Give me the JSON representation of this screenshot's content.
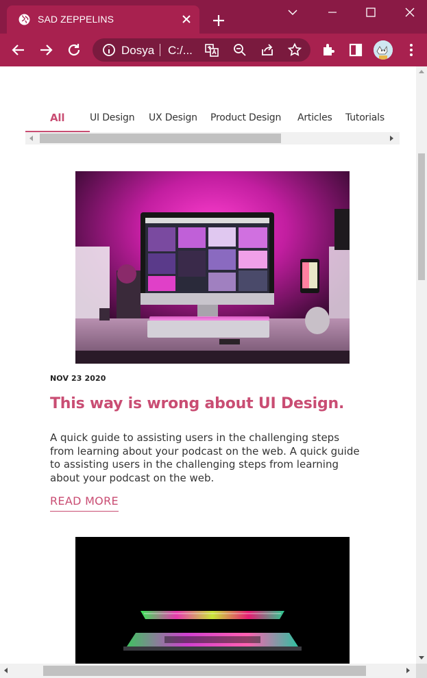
{
  "browser": {
    "tab_title": "SAD ZEPPELINS",
    "omnibox_site": "Dosya",
    "omnibox_path": "C:/...",
    "colors": {
      "frame": "#8a1a45",
      "toolbar": "#a8214f",
      "omnibox": "#7a1a3e"
    }
  },
  "categories": {
    "items": [
      {
        "label": "All",
        "active": true
      },
      {
        "label": "UI Design",
        "active": false
      },
      {
        "label": "UX Design",
        "active": false
      },
      {
        "label": "Product Design",
        "active": false
      },
      {
        "label": "Articles",
        "active": false
      },
      {
        "label": "Tutorials",
        "active": false
      }
    ]
  },
  "posts": [
    {
      "image": "desk-computer-pink-light",
      "date": "NOV 23 2020",
      "title": "This way is wrong about UI Design.",
      "excerpt": "A quick guide to assisting users in the challenging steps from learning about your podcast on the web. A quick guide to assisting users in the challenging steps from learning about your podcast on the web.",
      "read_more": "READ MORE"
    },
    {
      "image": "laptop-rgb-glow-dark"
    }
  ],
  "theme": {
    "accent": "#c94d73"
  }
}
